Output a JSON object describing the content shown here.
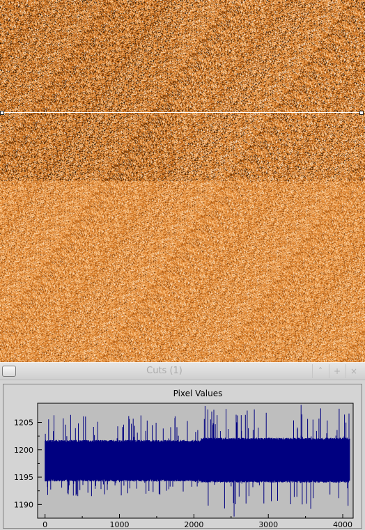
{
  "window": {
    "title": "Cuts (1)",
    "menu_icon": "window-menu-icon",
    "minimize_icon": "chevron-up-icon",
    "maximize_icon": "plus-icon",
    "close_icon": "close-icon",
    "minimize_glyph": "˄",
    "maximize_glyph": "+",
    "close_glyph": "×"
  },
  "image": {
    "colormap": [
      "#000000",
      "#8a3c00",
      "#d2751e",
      "#f2a254",
      "#ffd9a6",
      "#ffffff"
    ],
    "cut_line_color": "#ffffff"
  },
  "chart_data": {
    "type": "line",
    "title": "Pixel Values",
    "xlabel": "",
    "ylabel": "",
    "x_ticks": [
      0,
      1000,
      2000,
      3000,
      4000
    ],
    "y_ticks": [
      1190,
      1195,
      1200,
      1205
    ],
    "xlim": [
      -100,
      4140
    ],
    "ylim": [
      1187.5,
      1208.5
    ],
    "series": [
      {
        "color": "#000080",
        "n_points": 4096,
        "band_segments": [
          {
            "x_start": 0,
            "x_end": 2100,
            "core_low": 1194.2,
            "core_high": 1201.8,
            "spike_low": 1191.5,
            "spike_high": 1206.5
          },
          {
            "x_start": 2100,
            "x_end": 4096,
            "core_low": 1194.0,
            "core_high": 1202.2,
            "spike_low": 1189.0,
            "spike_high": 1208.0
          }
        ],
        "extremes": [
          {
            "x": 2150,
            "y": 1208.0
          },
          {
            "x": 2540,
            "y": 1187.8
          },
          {
            "x": 3440,
            "y": 1208.2
          },
          {
            "x": 3570,
            "y": 1189.2
          }
        ]
      }
    ]
  }
}
